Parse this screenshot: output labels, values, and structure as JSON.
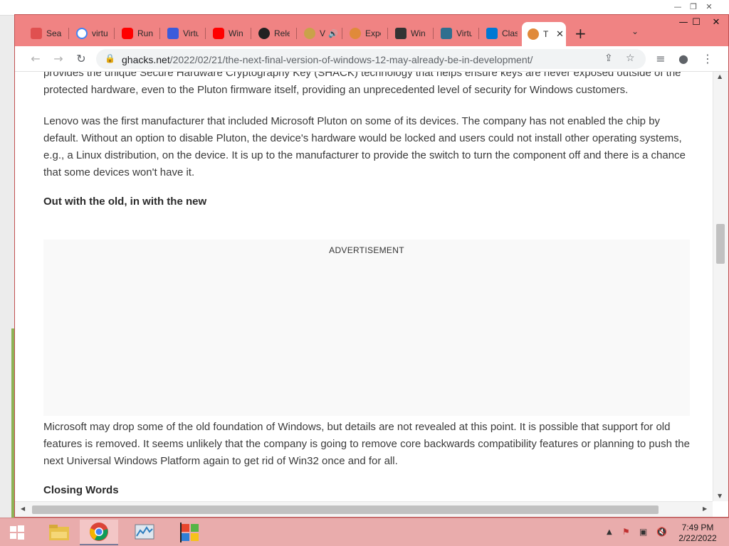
{
  "window_controls": {
    "minimize": "—",
    "maximize": "☐",
    "close": "✕"
  },
  "tabs": [
    {
      "title": "Sear",
      "icon": "search-favicon",
      "color": "#e05050"
    },
    {
      "title": "virtu",
      "icon": "google-favicon",
      "color": "#4285f4"
    },
    {
      "title": "Run",
      "icon": "youtube-favicon",
      "color": "#ff0000"
    },
    {
      "title": "Virtu",
      "icon": "virtualbox-favicon",
      "color": "#3b5bdb"
    },
    {
      "title": "Win",
      "icon": "youtube-favicon",
      "color": "#ff0000"
    },
    {
      "title": "Rele",
      "icon": "github-favicon",
      "color": "#222222"
    },
    {
      "title": "V",
      "icon": "doge-favicon",
      "color": "#c9a24a"
    },
    {
      "title": "Expe",
      "icon": "ghacks-favicon",
      "color": "#e08a3a"
    },
    {
      "title": "Win",
      "icon": "archive-favicon",
      "color": "#333333"
    },
    {
      "title": "Virtu",
      "icon": "vm-favicon",
      "color": "#2f6f8f"
    },
    {
      "title": "Clas",
      "icon": "azure-favicon",
      "color": "#0078d4"
    },
    {
      "title": "T",
      "icon": "ghacks-favicon",
      "color": "#e08a3a",
      "active": true
    }
  ],
  "new_tab_label": "+",
  "tab_search_label": "⌄",
  "address_bar": {
    "host": "ghacks.net",
    "path": "/2022/02/21/the-next-final-version-of-windows-12-may-already-be-in-development/"
  },
  "article": {
    "paragraph_top": "provides the unique Secure Hardware Cryptography Key (SHACK) technology that helps ensure keys are never exposed outside of the protected hardware, even to the Pluton firmware itself, providing an unprecedented level of security for Windows customers.",
    "paragraph_lenovo": "Lenovo was the first manufacturer that included Microsoft Pluton on some of its devices. The company has not enabled the chip by default. Without an option to disable Pluton, the device's hardware would be locked and users could not install other operating systems, e.g., a Linux distribution, on the device. It is up to the manufacturer to provide the switch to turn the component off and there is a chance that some devices won't have it.",
    "heading_out": "Out with the old, in with the new",
    "ad_label": "ADVERTISEMENT",
    "paragraph_microsoft": "Microsoft may drop some of the old foundation of Windows, but details are not revealed at this point. It is possible that support for old features is removed. It seems unlikely that the company is going to remove core backwards compatibility features or planning to push the next Universal Windows Platform again to get rid of Win32 once and for all.",
    "heading_closing": "Closing Words"
  },
  "taskbar": {
    "apps": [
      "start-icon",
      "file-explorer-icon",
      "chrome-icon",
      "task-manager-icon",
      "windows-flag-icon"
    ],
    "clock_time": "7:49 PM",
    "clock_date": "2/22/2022"
  }
}
